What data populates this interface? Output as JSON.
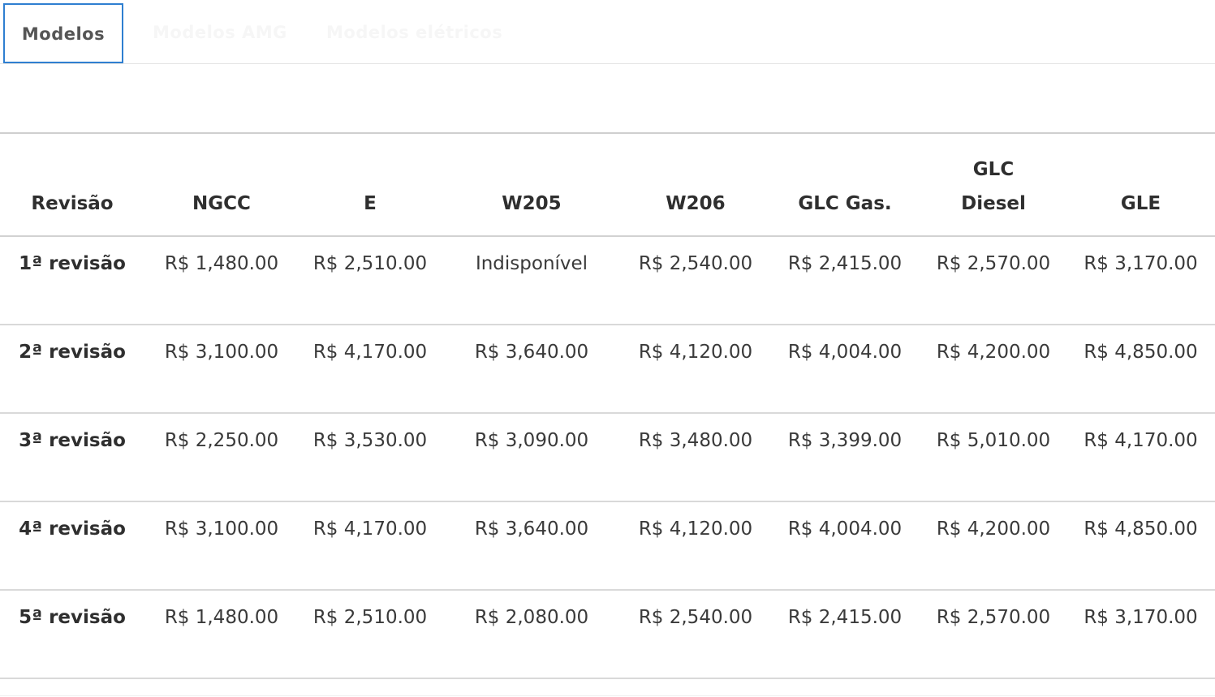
{
  "tabs": [
    {
      "label": "Modelos",
      "active": true
    },
    {
      "label": "Modelos AMG",
      "active": false
    },
    {
      "label": "Modelos elétricos",
      "active": false
    }
  ],
  "colors": {
    "active_tab_border": "#2f7fd1",
    "rule": "#d2d2d2"
  },
  "table": {
    "headers": [
      "Revisão",
      "NGCC",
      "E",
      "W205",
      "W206",
      "GLC Gas.",
      "GLC Diesel",
      "GLE"
    ],
    "rows": [
      {
        "label": "1ª revisão",
        "cells": [
          "R$ 1,480.00",
          "R$ 2,510.00",
          "Indisponível",
          "R$ 2,540.00",
          "R$ 2,415.00",
          "R$ 2,570.00",
          "R$ 3,170.00"
        ]
      },
      {
        "label": "2ª revisão",
        "cells": [
          "R$ 3,100.00",
          "R$ 4,170.00",
          "R$ 3,640.00",
          "R$ 4,120.00",
          "R$ 4,004.00",
          "R$ 4,200.00",
          "R$ 4,850.00"
        ]
      },
      {
        "label": "3ª revisão",
        "cells": [
          "R$ 2,250.00",
          "R$ 3,530.00",
          "R$ 3,090.00",
          "R$ 3,480.00",
          "R$ 3,399.00",
          "R$ 5,010.00",
          "R$ 4,170.00"
        ]
      },
      {
        "label": "4ª revisão",
        "cells": [
          "R$ 3,100.00",
          "R$ 4,170.00",
          "R$ 3,640.00",
          "R$ 4,120.00",
          "R$ 4,004.00",
          "R$ 4,200.00",
          "R$ 4,850.00"
        ]
      },
      {
        "label": "5ª revisão",
        "cells": [
          "R$ 1,480.00",
          "R$ 2,510.00",
          "R$ 2,080.00",
          "R$ 2,540.00",
          "R$ 2,415.00",
          "R$ 2,570.00",
          "R$ 3,170.00"
        ]
      }
    ]
  }
}
